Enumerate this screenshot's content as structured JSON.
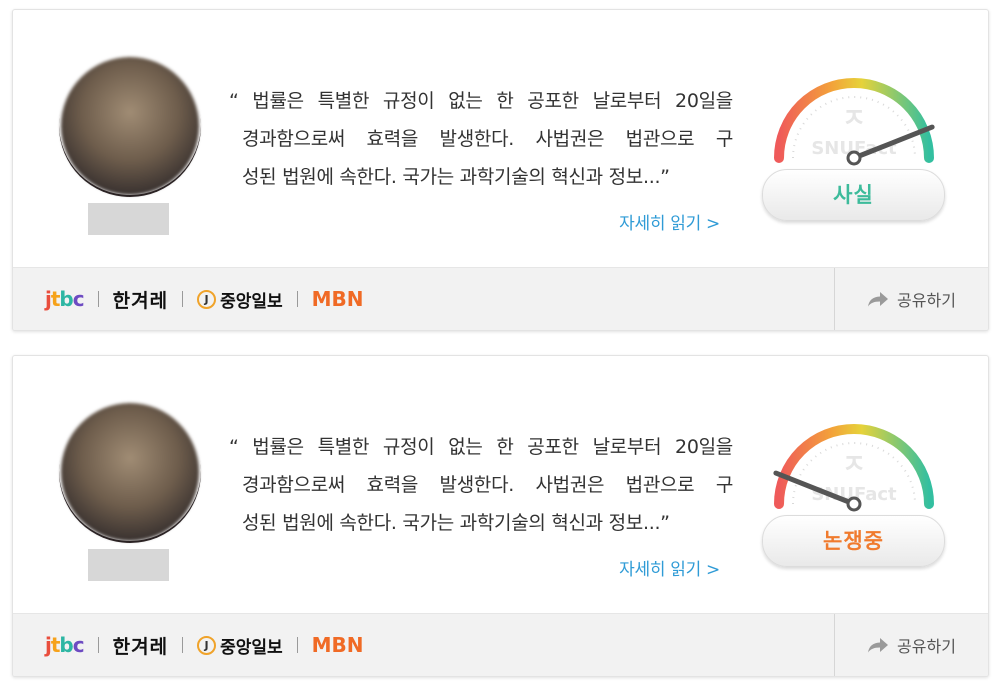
{
  "cards": [
    {
      "quote_lines": [
        "“ 법률은 특별한 규정이 없는 한 공포한 날로부터 20일을",
        "경과함으로써 효력을 발생한다. 사법권은 법관으로 구",
        "성된 법원에 속한다. 국가는 과학기술의 혁신과 정보...”"
      ],
      "more_label": "자세히 읽기 >",
      "gauge_brand": "SNUFact",
      "verdict_label": "사실",
      "verdict_color": "#3dbb9b",
      "needle_level": 0.88
    },
    {
      "quote_lines": [
        "“ 법률은 특별한 규정이 없는 한 공포한 날로부터 20일을",
        "경과함으로써 효력을 발생한다. 사법권은 법관으로 구",
        "성된 법원에 속한다. 국가는 과학기술의 혁신과 정보...”"
      ],
      "more_label": "자세히 읽기 >",
      "gauge_brand": "SNUFact",
      "verdict_label": "논쟁중",
      "verdict_color": "#f07b2e",
      "needle_level": 0.12
    }
  ],
  "footer": {
    "logos": {
      "jtbc": "JTBC",
      "hani": "한겨레",
      "joongang_badge": "J",
      "joongang": "중앙일보",
      "mbn": "MBN"
    },
    "share_label": "공유하기",
    "share_icon": "share-arrow-icon"
  }
}
